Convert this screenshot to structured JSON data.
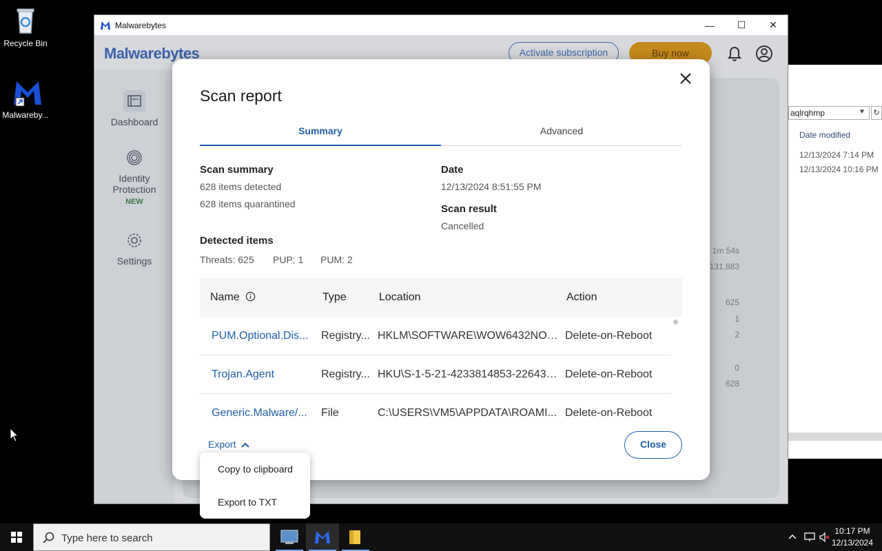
{
  "desktop": {
    "recycle_bin_label": "Recycle Bin",
    "malwarebytes_label": "Malwareby..."
  },
  "explorer": {
    "address_value": "aqlrqhmp",
    "column_header": "Date modified",
    "rows": [
      "12/13/2024 7:14 PM",
      "12/13/2024 10:16 PM"
    ]
  },
  "window": {
    "title": "Malwarebytes",
    "minimize_glyph": "—",
    "maximize_glyph": "☐",
    "close_glyph": "✕"
  },
  "app": {
    "wordmark": "Malwarebytes",
    "activate_label": "Activate subscription",
    "buy_now_label": "Buy now",
    "sidebar": {
      "dashboard": "Dashboard",
      "identity_line1": "Identity",
      "identity_line2": "Protection",
      "identity_badge": "NEW",
      "settings": "Settings"
    },
    "background_values": [
      "1m 54s",
      "131,883",
      "625",
      "1",
      "2",
      "0",
      "628"
    ]
  },
  "modal": {
    "title": "Scan report",
    "tabs": [
      {
        "label": "Summary",
        "active": true
      },
      {
        "label": "Advanced",
        "active": false
      }
    ],
    "scan_summary_heading": "Scan summary",
    "items_detected": "628 items detected",
    "items_quarantined": "628 items quarantined",
    "date_heading": "Date",
    "date_value": "12/13/2024 8:51:55 PM",
    "scan_result_heading": "Scan result",
    "scan_result_value": "Cancelled",
    "detected_items_heading": "Detected items",
    "counts": {
      "threats": "Threats: 625",
      "pup": "PUP: 1",
      "pum": "PUM: 2"
    },
    "table": {
      "headers": {
        "name": "Name",
        "type": "Type",
        "location": "Location",
        "action": "Action"
      },
      "rows": [
        {
          "name": "PUM.Optional.Dis...",
          "type": "Registry...",
          "location": "HKLM\\SOFTWARE\\WOW6432NOD...",
          "action": "Delete-on-Reboot"
        },
        {
          "name": "Trojan.Agent",
          "type": "Registry...",
          "location": "HKU\\S-1-5-21-4233814853-226430...",
          "action": "Delete-on-Reboot"
        },
        {
          "name": "Generic.Malware/...",
          "type": "File",
          "location": "C:\\USERS\\VM5\\APPDATA\\ROAMI...",
          "action": "Delete-on-Reboot"
        }
      ]
    },
    "export_label": "Export",
    "close_label": "Close",
    "export_menu": [
      "Copy to clipboard",
      "Export to TXT"
    ]
  },
  "taskbar": {
    "search_placeholder": "Type here to search",
    "time": "10:17 PM",
    "date": "12/13/2024"
  },
  "colors": {
    "accent_blue": "#1f5fa8",
    "buy_now": "#c58a1d",
    "new_badge": "#3c7a4a"
  }
}
